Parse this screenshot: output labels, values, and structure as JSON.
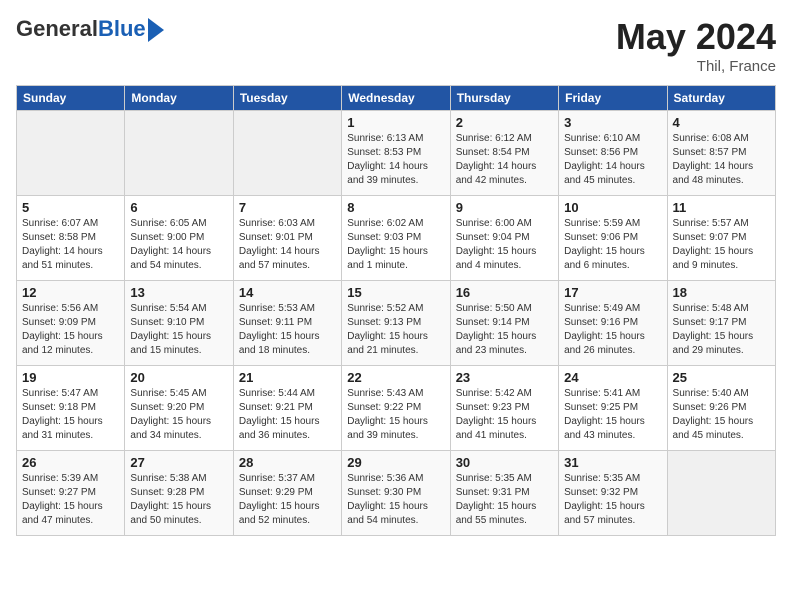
{
  "header": {
    "logo_line1": "General",
    "logo_line2": "Blue",
    "month_year": "May 2024",
    "location": "Thil, France"
  },
  "days_of_week": [
    "Sunday",
    "Monday",
    "Tuesday",
    "Wednesday",
    "Thursday",
    "Friday",
    "Saturday"
  ],
  "weeks": [
    [
      {
        "num": "",
        "info": ""
      },
      {
        "num": "",
        "info": ""
      },
      {
        "num": "",
        "info": ""
      },
      {
        "num": "1",
        "info": "Sunrise: 6:13 AM\nSunset: 8:53 PM\nDaylight: 14 hours\nand 39 minutes."
      },
      {
        "num": "2",
        "info": "Sunrise: 6:12 AM\nSunset: 8:54 PM\nDaylight: 14 hours\nand 42 minutes."
      },
      {
        "num": "3",
        "info": "Sunrise: 6:10 AM\nSunset: 8:56 PM\nDaylight: 14 hours\nand 45 minutes."
      },
      {
        "num": "4",
        "info": "Sunrise: 6:08 AM\nSunset: 8:57 PM\nDaylight: 14 hours\nand 48 minutes."
      }
    ],
    [
      {
        "num": "5",
        "info": "Sunrise: 6:07 AM\nSunset: 8:58 PM\nDaylight: 14 hours\nand 51 minutes."
      },
      {
        "num": "6",
        "info": "Sunrise: 6:05 AM\nSunset: 9:00 PM\nDaylight: 14 hours\nand 54 minutes."
      },
      {
        "num": "7",
        "info": "Sunrise: 6:03 AM\nSunset: 9:01 PM\nDaylight: 14 hours\nand 57 minutes."
      },
      {
        "num": "8",
        "info": "Sunrise: 6:02 AM\nSunset: 9:03 PM\nDaylight: 15 hours\nand 1 minute."
      },
      {
        "num": "9",
        "info": "Sunrise: 6:00 AM\nSunset: 9:04 PM\nDaylight: 15 hours\nand 4 minutes."
      },
      {
        "num": "10",
        "info": "Sunrise: 5:59 AM\nSunset: 9:06 PM\nDaylight: 15 hours\nand 6 minutes."
      },
      {
        "num": "11",
        "info": "Sunrise: 5:57 AM\nSunset: 9:07 PM\nDaylight: 15 hours\nand 9 minutes."
      }
    ],
    [
      {
        "num": "12",
        "info": "Sunrise: 5:56 AM\nSunset: 9:09 PM\nDaylight: 15 hours\nand 12 minutes."
      },
      {
        "num": "13",
        "info": "Sunrise: 5:54 AM\nSunset: 9:10 PM\nDaylight: 15 hours\nand 15 minutes."
      },
      {
        "num": "14",
        "info": "Sunrise: 5:53 AM\nSunset: 9:11 PM\nDaylight: 15 hours\nand 18 minutes."
      },
      {
        "num": "15",
        "info": "Sunrise: 5:52 AM\nSunset: 9:13 PM\nDaylight: 15 hours\nand 21 minutes."
      },
      {
        "num": "16",
        "info": "Sunrise: 5:50 AM\nSunset: 9:14 PM\nDaylight: 15 hours\nand 23 minutes."
      },
      {
        "num": "17",
        "info": "Sunrise: 5:49 AM\nSunset: 9:16 PM\nDaylight: 15 hours\nand 26 minutes."
      },
      {
        "num": "18",
        "info": "Sunrise: 5:48 AM\nSunset: 9:17 PM\nDaylight: 15 hours\nand 29 minutes."
      }
    ],
    [
      {
        "num": "19",
        "info": "Sunrise: 5:47 AM\nSunset: 9:18 PM\nDaylight: 15 hours\nand 31 minutes."
      },
      {
        "num": "20",
        "info": "Sunrise: 5:45 AM\nSunset: 9:20 PM\nDaylight: 15 hours\nand 34 minutes."
      },
      {
        "num": "21",
        "info": "Sunrise: 5:44 AM\nSunset: 9:21 PM\nDaylight: 15 hours\nand 36 minutes."
      },
      {
        "num": "22",
        "info": "Sunrise: 5:43 AM\nSunset: 9:22 PM\nDaylight: 15 hours\nand 39 minutes."
      },
      {
        "num": "23",
        "info": "Sunrise: 5:42 AM\nSunset: 9:23 PM\nDaylight: 15 hours\nand 41 minutes."
      },
      {
        "num": "24",
        "info": "Sunrise: 5:41 AM\nSunset: 9:25 PM\nDaylight: 15 hours\nand 43 minutes."
      },
      {
        "num": "25",
        "info": "Sunrise: 5:40 AM\nSunset: 9:26 PM\nDaylight: 15 hours\nand 45 minutes."
      }
    ],
    [
      {
        "num": "26",
        "info": "Sunrise: 5:39 AM\nSunset: 9:27 PM\nDaylight: 15 hours\nand 47 minutes."
      },
      {
        "num": "27",
        "info": "Sunrise: 5:38 AM\nSunset: 9:28 PM\nDaylight: 15 hours\nand 50 minutes."
      },
      {
        "num": "28",
        "info": "Sunrise: 5:37 AM\nSunset: 9:29 PM\nDaylight: 15 hours\nand 52 minutes."
      },
      {
        "num": "29",
        "info": "Sunrise: 5:36 AM\nSunset: 9:30 PM\nDaylight: 15 hours\nand 54 minutes."
      },
      {
        "num": "30",
        "info": "Sunrise: 5:35 AM\nSunset: 9:31 PM\nDaylight: 15 hours\nand 55 minutes."
      },
      {
        "num": "31",
        "info": "Sunrise: 5:35 AM\nSunset: 9:32 PM\nDaylight: 15 hours\nand 57 minutes."
      },
      {
        "num": "",
        "info": ""
      }
    ]
  ]
}
